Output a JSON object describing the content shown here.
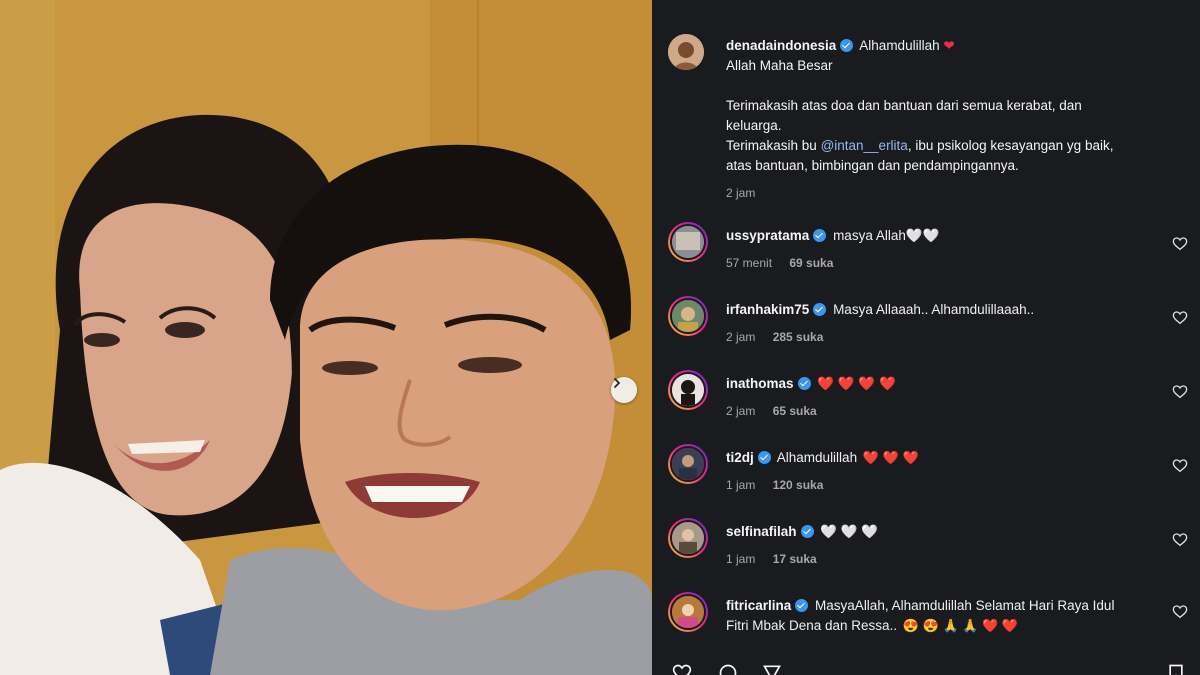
{
  "post": {
    "username": "denadaindonesia",
    "lines": [
      "Alhamdulillah",
      "Allah Maha Besar",
      "Terimakasih atas doa dan bantuan dari semua kerabat, dan",
      "keluarga.",
      "Terimakasih bu",
      "@intan__erlita",
      ", ibu psikolog kesayangan yg baik,",
      "atas bantuan, bimbingan dan pendampingannya."
    ],
    "time": "2 jam",
    "colors": {
      "heart": "#ed2f45",
      "verified": "#3b96f0",
      "mention": "#98b8f0"
    }
  },
  "comments": [
    {
      "username": "ussypratama",
      "text": "masya Allah🤍🤍",
      "time": "57 menit",
      "likes": "69 suka"
    },
    {
      "username": "irfanhakim75",
      "text": "Masya Allaaah.. Alhamdulillaaah..",
      "time": "2 jam",
      "likes": "285 suka"
    },
    {
      "username": "inathomas",
      "text": "❤️ ❤️ ❤️ ❤️",
      "time": "2 jam",
      "likes": "65 suka"
    },
    {
      "username": "ti2dj",
      "text": "Alhamdulillah",
      "emoji": "❤️ ❤️ ❤️",
      "time": "1 jam",
      "likes": "120 suka"
    },
    {
      "username": "selfinafilah",
      "text": "🤍 🤍 🤍",
      "time": "1 jam",
      "likes": "17 suka"
    },
    {
      "username": "fitricarlina",
      "text": "MasyaAllah, Alhamdulillah Selamat Hari Raya Idul",
      "text2": "Fitri Mbak Dena dan Ressa..",
      "emoji": "😍 😍 🙏 🙏 ❤️ ❤️"
    }
  ],
  "icons": {
    "like": "heart-outline-icon",
    "verified": "verified-badge-icon",
    "next": "chevron-right-icon"
  }
}
